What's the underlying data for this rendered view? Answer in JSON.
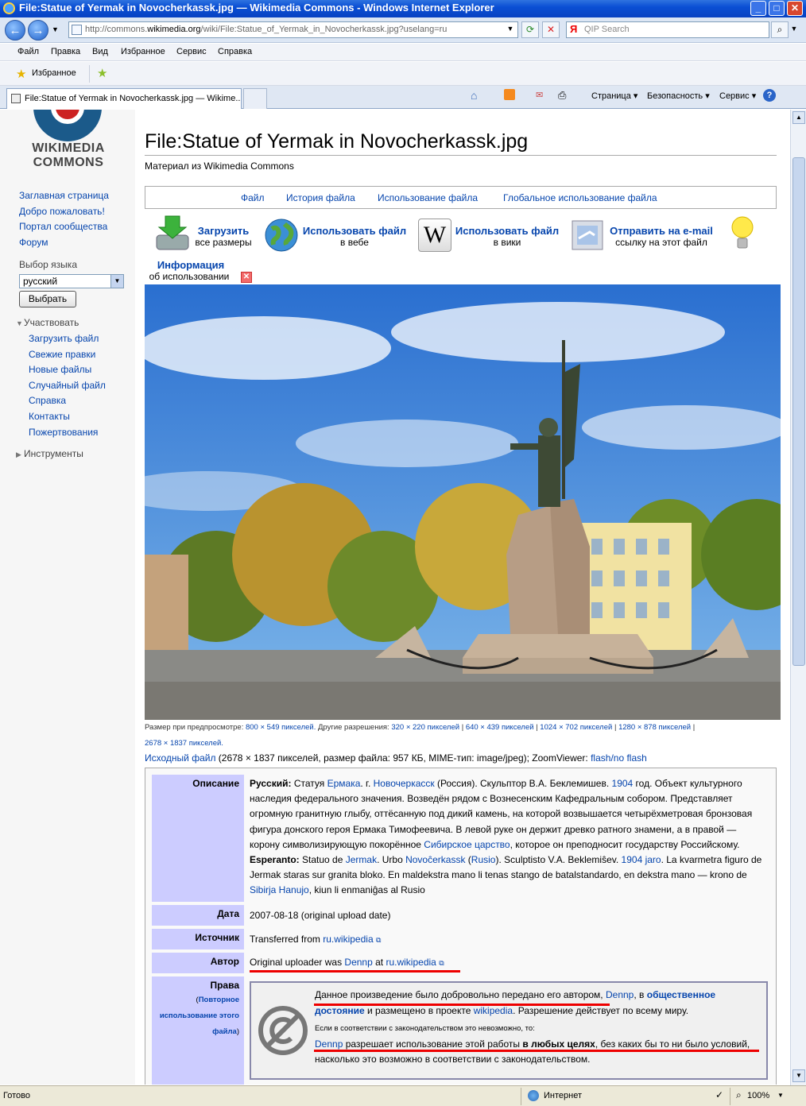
{
  "window": {
    "title": "File:Statue of Yermak in Novocherkassk.jpg — Wikimedia Commons - Windows Internet Explorer"
  },
  "address": {
    "url_prefix": "http://commons.",
    "url_domain": "wikimedia.org",
    "url_suffix": "/wiki/File:Statue_of_Yermak_in_Novocherkassk.jpg?uselang=ru",
    "search_placeholder": "QIP Search",
    "search_logo": "Я"
  },
  "menu": [
    "Файл",
    "Правка",
    "Вид",
    "Избранное",
    "Сервис",
    "Справка"
  ],
  "favorites": {
    "label": "Избранное"
  },
  "tab": {
    "label": "File:Statue of Yermak in Novocherkassk.jpg — Wikime..."
  },
  "commandbar": {
    "page": "Страница ▾",
    "security": "Безопасность ▾",
    "tools": "Сервис ▾"
  },
  "logo": {
    "line1": "WIKIMEDIA",
    "line2": "COMMONS"
  },
  "sidebar": {
    "nav": [
      "Заглавная страница",
      "Добро пожаловать!",
      "Портал сообщества",
      "Форум"
    ],
    "lang_label": "Выбор языка",
    "lang_value": "русский",
    "lang_button": "Выбрать",
    "participate": "Участвовать",
    "participate_items": [
      "Загрузить файл",
      "Свежие правки",
      "Новые файлы",
      "Случайный файл",
      "Справка",
      "Контакты",
      "Пожертвования"
    ],
    "tools": "Инструменты"
  },
  "page": {
    "title": "File:Statue of Yermak in Novocherkassk.jpg",
    "from": "Материал из Wikimedia Commons",
    "tabs": [
      "Файл",
      "История файла",
      "Использование файла",
      "Глобальное использование файла"
    ]
  },
  "tools": {
    "upload_title": "Загрузить",
    "upload_sub": "все размеры",
    "web_title": "Использовать файл",
    "web_sub": "в вебе",
    "wiki_title": "Использовать файл",
    "wiki_sub": "в вики",
    "mail_title": "Отправить на e-mail",
    "mail_sub": "ссылку на этот файл",
    "info_title": "Информация",
    "info_sub": "об использовании"
  },
  "res": {
    "preview_label": "Размер при предпросмотре:",
    "preview_size": "800 × 549 пикселей.",
    "other_label": "Другие разрешения:",
    "r1": "320 × 220 пикселей",
    "r2": "640 × 439 пикселей",
    "r3": "1024 × 702 пикселей",
    "r4": "1280 × 878 пикселей",
    "r5": "2678 × 1837 пикселей.",
    "orig_link": "Исходный файл",
    "orig_text": " (2678 × 1837 пикселей, размер файла: 957 КБ, MIME-тип: image/jpeg); ZoomViewer: ",
    "zoom_link": "flash/no flash"
  },
  "info": {
    "desc_label": "Описание",
    "date_label": "Дата",
    "date_value": "2007-08-18 (original upload date)",
    "source_label": "Источник",
    "source_text": "Transferred from ",
    "source_link": "ru.wikipedia",
    "author_label": "Автор",
    "author_text": "Original uploader was ",
    "author_user": "Dennp",
    "author_at": " at ",
    "author_link": "ru.wikipedia",
    "rights_label": "Права",
    "rights_sub_open": "(",
    "rights_sub_link": "Повторное использование этого файла",
    "rights_sub_close": ")",
    "ru_label": "Русский:",
    "ru_t1": " Статуя ",
    "ru_l1": "Ермака",
    "ru_t2": ". г. ",
    "ru_l2": "Новочеркасск",
    "ru_t3": " (Россия). Скульптор В.А. Беклемишев. ",
    "ru_l3": "1904",
    "ru_t4": " год. Объект культурного наследия федерального значения. Возведён рядом с Вознесенским Кафедральным собором. Представляет огромную гранитную глыбу, оттёсанную под дикий камень, на которой возвышается четырёхметровая бронзовая фигура донского героя Ермака Тимофеевича. В левой руке он держит древко ратного знамени, а в правой — корону символизирующую покорённое ",
    "ru_l4": "Сибирское царство",
    "ru_t5": ", которое он преподносит государству Российскому.",
    "eo_label": "Esperanto:",
    "eo_t1": " Statuo de ",
    "eo_l1": "Jermak",
    "eo_t2": ". Urbo ",
    "eo_l2": "Novoĉerkassk",
    "eo_t3": " (",
    "eo_l3": "Rusio",
    "eo_t4": "). Sculptisto V.A. Beklemiŝev. ",
    "eo_l4": "1904 jaro",
    "eo_t5": ". La kvarmetra figuro de Jermak staras sur granita bloko. En maldekstra mano li tenas stango de batalstandardo, en dekstra mano — krono de ",
    "eo_l5": "Sibirja Hanujo",
    "eo_t6": ", kiun li enmaniĝas al Rusio"
  },
  "pd": {
    "t1": "Данное произведение было добровольно передано его автором, ",
    "user": "Dennp",
    "t2": ", в ",
    "l_pd": "общественное достояние",
    "t3": " и размещено в проекте ",
    "l_wp": "wikipedia",
    "t4": ". Разрешение действует по всему миру.",
    "small": "Если в соответствии с законодательством это невозможно, то:",
    "user2": "Dennp",
    "t5": " разрешает использование этой работы ",
    "bold": "в любых целях",
    "t6": ", без каких бы то ни было условий, насколько это возможно в соответствии с законодательством."
  },
  "status": {
    "left": "Готово",
    "zone": "Интернет",
    "zoom": "100%"
  },
  "colors": {
    "accent_red": "#e00000",
    "link": "#0645ad",
    "label_bg": "#ccccff"
  }
}
